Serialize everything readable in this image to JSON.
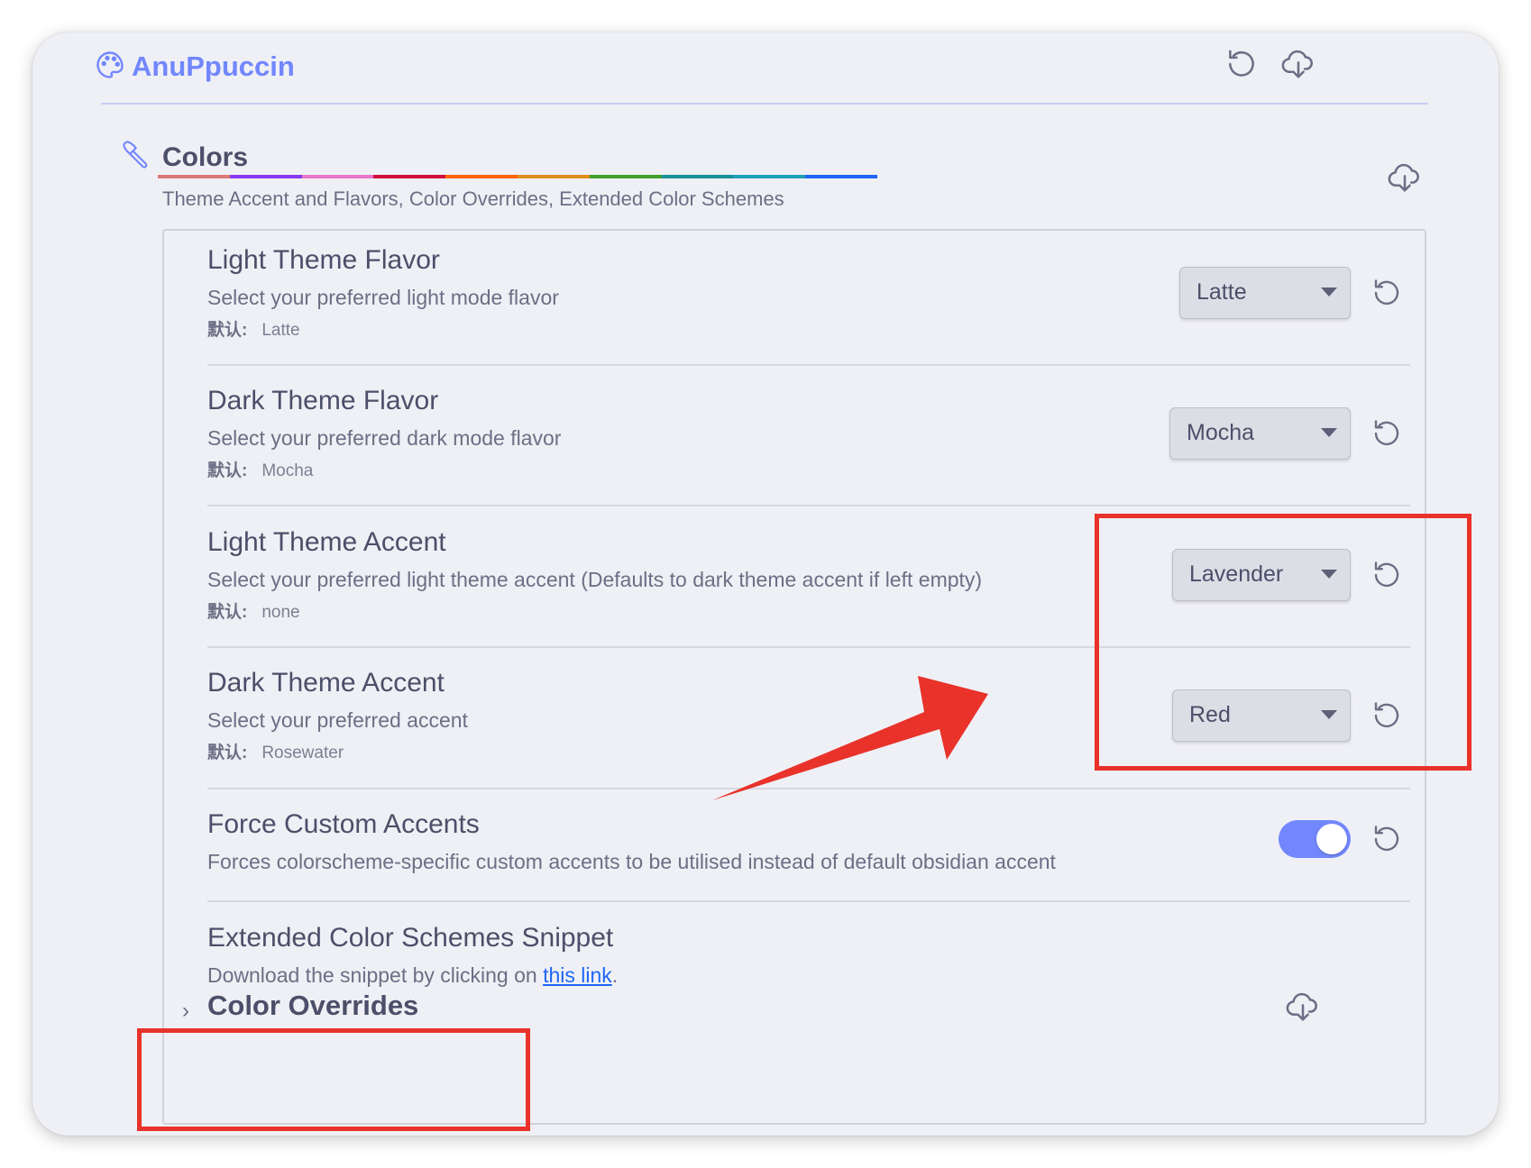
{
  "header": {
    "title": "AnuPpuccin",
    "brand_icon": "palette-icon",
    "actions": [
      "reset-icon",
      "download-icon"
    ]
  },
  "section": {
    "title": "Colors",
    "description": "Theme Accent and Flavors, Color Overrides, Extended Color Schemes",
    "icon": "brush-icon",
    "rainbow": [
      "#dd7878",
      "#8839ef",
      "#ea76cb",
      "#d20f39",
      "#fe640b",
      "#df8e1d",
      "#40a02b",
      "#179299",
      "#209fb5",
      "#1e66f5"
    ]
  },
  "settings": [
    {
      "title": "Light Theme Flavor",
      "description": "Select your preferred light mode flavor",
      "default_label": "默认:",
      "default_value": "Latte",
      "value": "Latte"
    },
    {
      "title": "Dark Theme Flavor",
      "description": "Select your preferred dark mode flavor",
      "default_label": "默认:",
      "default_value": "Mocha",
      "value": "Mocha"
    },
    {
      "title": "Light Theme Accent",
      "description": "Select your preferred light theme accent (Defaults to dark theme accent if left empty)",
      "default_label": "默认:",
      "default_value": "none",
      "value": "Lavender"
    },
    {
      "title": "Dark Theme Accent",
      "description": "Select your preferred accent",
      "default_label": "默认:",
      "default_value": "Rosewater",
      "value": "Red"
    },
    {
      "title": "Force Custom Accents",
      "description": "Forces colorscheme-specific custom accents to be utilised instead of default obsidian accent",
      "toggle_on": true
    }
  ],
  "snippet": {
    "title": "Extended Color Schemes Snippet",
    "description_prefix": "Download the snippet by clicking on ",
    "link_text": "this link",
    "description_suffix": "."
  },
  "overrides": {
    "title": "Color Overrides"
  },
  "colors": {
    "accent": "#7287fd",
    "annotation": "#e8322a",
    "link": "#1e66f5"
  }
}
